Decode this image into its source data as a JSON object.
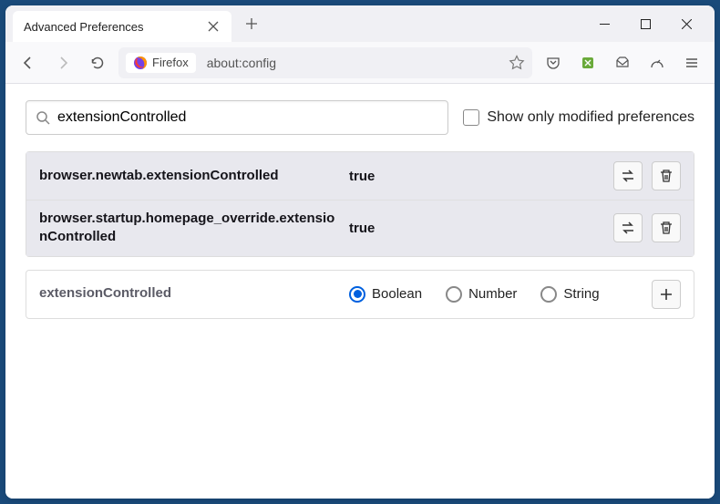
{
  "window": {
    "tab_title": "Advanced Preferences"
  },
  "urlbar": {
    "identity_label": "Firefox",
    "url": "about:config"
  },
  "search": {
    "value": "extensionControlled",
    "checkbox_label": "Show only modified preferences"
  },
  "prefs": [
    {
      "name": "browser.newtab.extensionControlled",
      "value": "true"
    },
    {
      "name": "browser.startup.homepage_override.extensionControlled",
      "value": "true"
    }
  ],
  "newpref": {
    "name": "extensionControlled",
    "types": {
      "boolean": "Boolean",
      "number": "Number",
      "string": "String"
    }
  }
}
